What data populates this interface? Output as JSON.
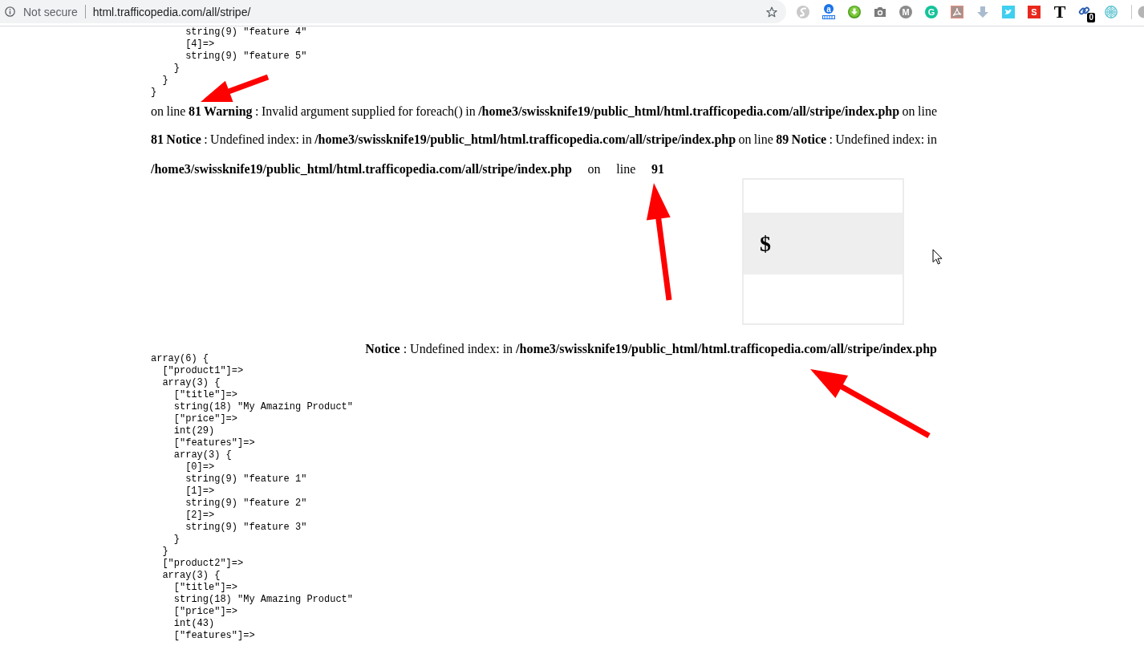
{
  "browser": {
    "security": "Not secure",
    "url": "html.trafficopedia.com/all/stripe/",
    "extensions": [
      {
        "kind": "swirl"
      },
      {
        "kind": "badge",
        "letter": "a"
      },
      {
        "kind": "download"
      },
      {
        "kind": "camera"
      },
      {
        "kind": "letter_circle",
        "letter": "M",
        "color": "#8c8c8c"
      },
      {
        "kind": "letter_circle",
        "letter": "G",
        "color": "#15c39a"
      },
      {
        "kind": "acrobat"
      },
      {
        "kind": "down_arrow"
      },
      {
        "kind": "bird"
      },
      {
        "kind": "letter_tile",
        "letter": "S",
        "color": "#e8281c"
      },
      {
        "kind": "serif_letter",
        "letter": "T"
      },
      {
        "kind": "link_count",
        "count": "0"
      },
      {
        "kind": "web"
      }
    ]
  },
  "top_dump": [
    {
      "children": [
        {
          "children": [
            {
              "children": [
                {
                  "text": "string(9) \"feature 4\""
                },
                {
                  "text": "[4]=>"
                },
                {
                  "text": "string(9) \"feature 5\""
                }
              ]
            },
            {
              "text": "}"
            }
          ]
        },
        {
          "text": "}"
        }
      ]
    },
    {
      "text": "}"
    }
  ],
  "error_lines": [
    "on line **81 Warning** : Invalid argument supplied for foreach() in **/home3/swissknife19/public_html/html.trafficopedia.com/all/stripe/index.php** on line",
    "**81 Notice** : Undefined index: in **/home3/swissknife19/public_html/html.trafficopedia.com/all/stripe/index.php** on line **89 Notice** : Undefined index: in",
    "**/home3/swissknife19/public_html/html.trafficopedia.com/all/stripe/index.php** on line **91**"
  ],
  "price_box": {
    "symbol": "$"
  },
  "notice": "**Notice** : Undefined index: in **/home3/swissknife19/public_html/html.trafficopedia.com/all/stripe/index.php**",
  "bottom_dump": [
    {
      "text": "array(6) {",
      "children": [
        {
          "text": "[\"product1\"]=>"
        },
        {
          "text": "array(3) {",
          "children": [
            {
              "text": "[\"title\"]=>"
            },
            {
              "text": "string(18) \"My Amazing Product\""
            },
            {
              "text": "[\"price\"]=>"
            },
            {
              "text": "int(29)"
            },
            {
              "text": "[\"features\"]=>"
            },
            {
              "text": "array(3) {",
              "children": [
                {
                  "text": "[0]=>"
                },
                {
                  "text": "string(9) \"feature 1\""
                },
                {
                  "text": "[1]=>"
                },
                {
                  "text": "string(9) \"feature 2\""
                },
                {
                  "text": "[2]=>"
                },
                {
                  "text": "string(9) \"feature 3\""
                }
              ]
            },
            {
              "text": "}"
            }
          ]
        },
        {
          "text": "}"
        },
        {
          "text": "[\"product2\"]=>"
        },
        {
          "text": "array(3) {",
          "children": [
            {
              "text": "[\"title\"]=>"
            },
            {
              "text": "string(18) \"My Amazing Product\""
            },
            {
              "text": "[\"price\"]=>"
            },
            {
              "text": "int(43)"
            },
            {
              "text": "[\"features\"]=>"
            }
          ]
        }
      ]
    }
  ]
}
